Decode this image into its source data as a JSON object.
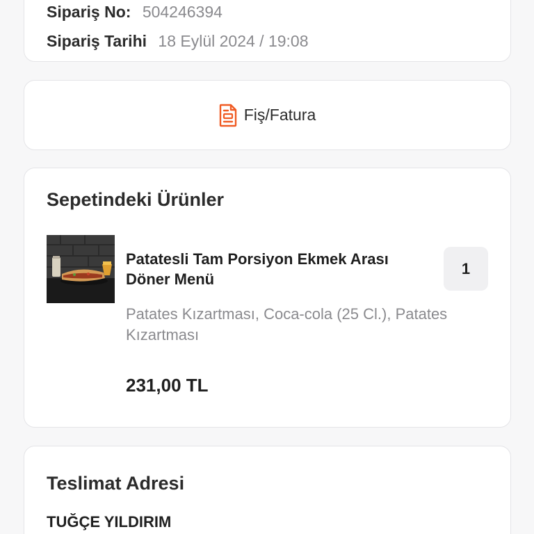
{
  "order": {
    "order_no_label": "Sipariş No:",
    "order_no_value": "504246394",
    "order_date_label": "Sipariş Tarihi",
    "order_date_value": "18 Eylül 2024 / 19:08"
  },
  "receipt": {
    "label": "Fiş/Fatura",
    "icon": "receipt-document-icon",
    "icon_color": "#f05a22"
  },
  "basket": {
    "title": "Sepetindeki Ürünler",
    "items": [
      {
        "name": "Patatesli Tam Porsiyon Ekmek Arası Döner Menü",
        "quantity": "1",
        "options": "Patates Kızartması, Coca-cola (25 Cl.), Patates Kızartması",
        "price": "231,00 TL",
        "image": "doner-sandwich-menu-photo"
      }
    ]
  },
  "address": {
    "title": "Teslimat Adresi",
    "recipient": "TUĞÇE YILDIRIM"
  }
}
